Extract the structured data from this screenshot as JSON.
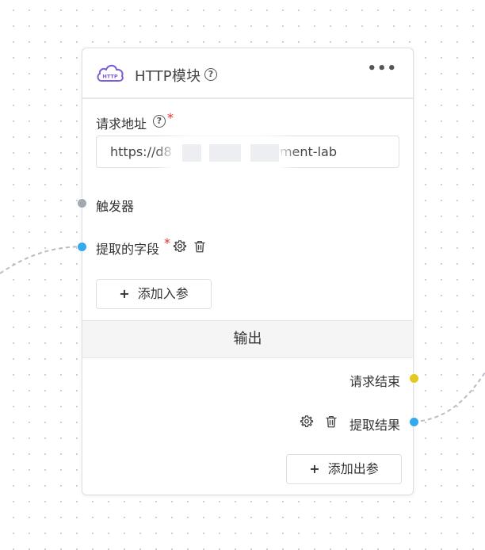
{
  "node": {
    "icon_text": "HTTP",
    "title": "HTTP模块",
    "help_glyph": "?",
    "more_glyph": "•••",
    "url": {
      "label": "请求地址",
      "required_mark": "*",
      "value_start": "https://d8",
      "value_end": "tment-lab"
    },
    "trigger_label": "触发器",
    "extract_field": {
      "label": "提取的字段",
      "required_mark": "*"
    },
    "add_input_button": {
      "plus": "+",
      "label": "添加入参"
    },
    "output_section": {
      "title": "输出",
      "items": [
        "请求结束",
        "提取结果"
      ]
    },
    "add_output_button": {
      "plus": "+",
      "label": "添加出参"
    }
  },
  "colors": {
    "accent_purple": "#7b5bd6",
    "port_grey": "#a3a8b1",
    "port_blue": "#34a9ec",
    "port_yellow": "#e3c91b",
    "required_red": "#e5322d"
  },
  "icons": [
    "http-cloud-icon",
    "help-icon",
    "more-icon",
    "gear-icon",
    "trash-icon",
    "plus-icon"
  ]
}
